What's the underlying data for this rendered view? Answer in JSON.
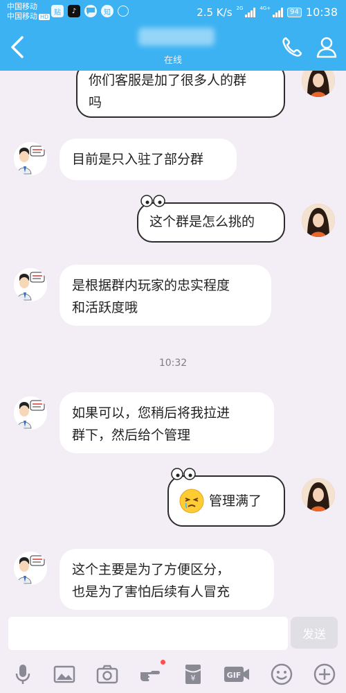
{
  "status_bar": {
    "carrier_1": "中国移动",
    "carrier_2": "中国移动",
    "hd_badge": "HD",
    "app_icon_1": "贴",
    "app_icon_2": "♪",
    "app_icon_4": "知",
    "net_speed": "2.5 K/s",
    "signal_1_label": "2G",
    "signal_2_label": "4G+",
    "battery": "94",
    "time": "10:38"
  },
  "header": {
    "title": "",
    "status": "在线",
    "back_icon": "chevron-left-icon",
    "phone_icon": "phone-icon",
    "profile_icon": "person-icon"
  },
  "messages": [
    {
      "side": "right",
      "style": "handwritten",
      "lines": [
        "你们客服是加了很多人的群",
        "吗"
      ]
    },
    {
      "side": "left",
      "lines": [
        "目前是只入驻了部分群"
      ]
    },
    {
      "side": "right",
      "style": "handwritten",
      "lines": [
        "这个群是怎么挑的"
      ]
    },
    {
      "side": "left",
      "lines": [
        "是根据群内玩家的忠实程度",
        "和活跃度哦"
      ]
    },
    {
      "side": "left",
      "lines": [
        "如果可以，您稍后将我拉进",
        "群下，然后给个管理"
      ]
    },
    {
      "side": "right",
      "style": "handwritten",
      "lines": [
        "管理满了"
      ]
    },
    {
      "side": "left",
      "lines": [
        "这个主要是为了方便区分，",
        "也是为了害怕后续有人冒充"
      ]
    }
  ],
  "timestamp": "10:32",
  "input": {
    "placeholder": "",
    "send_label": "发送"
  },
  "toolbar": {
    "gif_label": "GIF",
    "redpacket_label": "¥"
  },
  "colors": {
    "accent": "#3db2f3",
    "background": "#f3eef6",
    "bubble": "#ffffff",
    "notification_dot": "#ff4d4d"
  }
}
